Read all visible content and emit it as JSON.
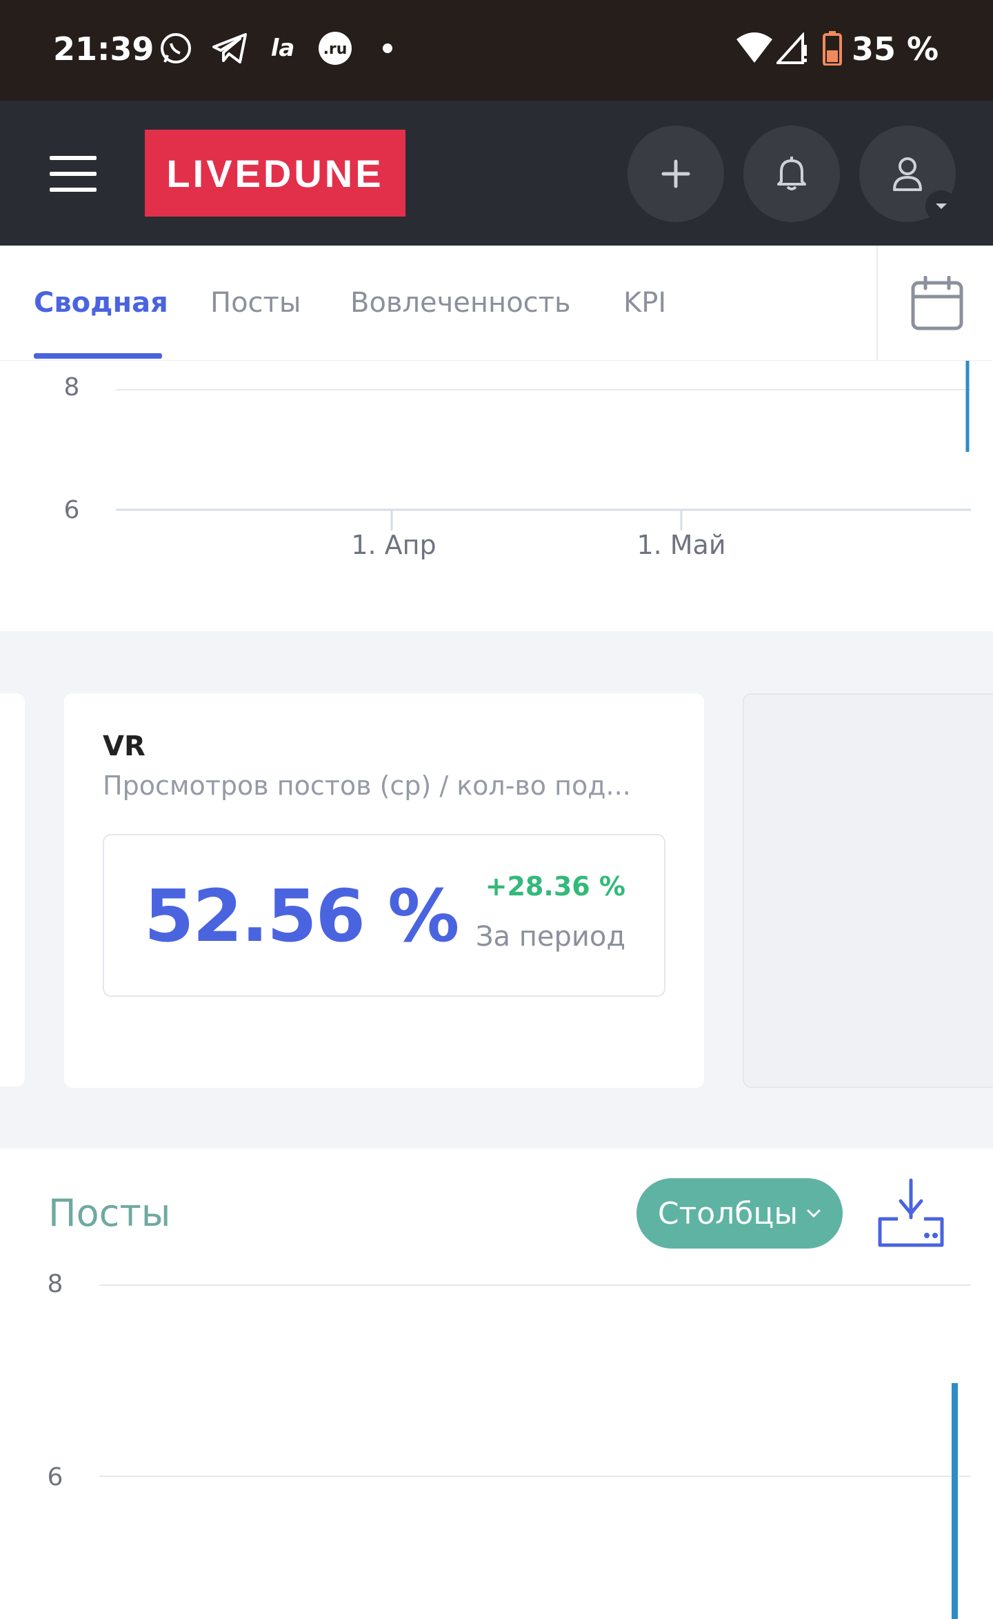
{
  "status_bar": {
    "time": "21:39",
    "battery": "35 %",
    "icons": [
      "whatsapp-icon",
      "telegram-icon",
      "la-icon",
      "ru-icon",
      "dot-icon",
      "wifi-icon",
      "signal-icon",
      "battery-icon"
    ]
  },
  "header": {
    "logo": "LIVEDUNE",
    "buttons": [
      "plus-icon",
      "bell-icon",
      "user-icon"
    ]
  },
  "tabs": [
    {
      "label": "Сводная",
      "active": true
    },
    {
      "label": "Посты",
      "active": false
    },
    {
      "label": "Вовлеченность",
      "active": false
    },
    {
      "label": "KPI",
      "active": false
    }
  ],
  "top_chart": {
    "y_ticks": [
      "8",
      "6"
    ],
    "x_ticks": [
      "1. Апр",
      "1. Май"
    ]
  },
  "vr_card": {
    "title": "VR",
    "subtitle": "Просмотров постов (ср) / кол-во под...",
    "value": "52.56 %",
    "delta": "+28.36 %",
    "period": "За период"
  },
  "posts_section": {
    "title": "Посты",
    "columns_button": "Столбцы",
    "y_ticks": [
      "8",
      "6"
    ]
  },
  "colors": {
    "accent": "#4a64e0",
    "brand": "#e3304a",
    "positive": "#33b97a",
    "teal": "#5fb3a3",
    "series": "#2f8cc4"
  }
}
